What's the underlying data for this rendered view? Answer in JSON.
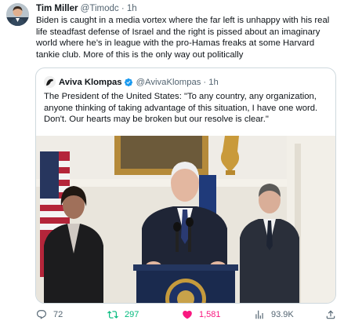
{
  "author": {
    "name": "Tim Miller",
    "handle": "@Timodc",
    "separator": "·",
    "time": "1h"
  },
  "tweet_text": "Biden is caught in a media vortex where the far left is unhappy with his real life steadfast defense of Israel and the right is pissed about an imaginary world where he’s in league with the pro-Hamas freaks at some Harvard tankie club. More of this is the only way out politically",
  "quote": {
    "name": "Aviva Klompas",
    "handle": "@AvivaKlompas",
    "separator": "·",
    "time": "1h",
    "text": "The President of the United States: \"To any country, any organization, anyone thinking of taking advantage of this situation, I have one word. Don't. Our hearts may be broken but our resolve is clear.\""
  },
  "actions": {
    "replies": "72",
    "reposts": "297",
    "likes": "1,581",
    "views": "93.9K"
  },
  "colors": {
    "repost_active": "#00ba7c",
    "like_active": "#f91880",
    "verified": "#1d9bf0",
    "muted": "#536471"
  }
}
